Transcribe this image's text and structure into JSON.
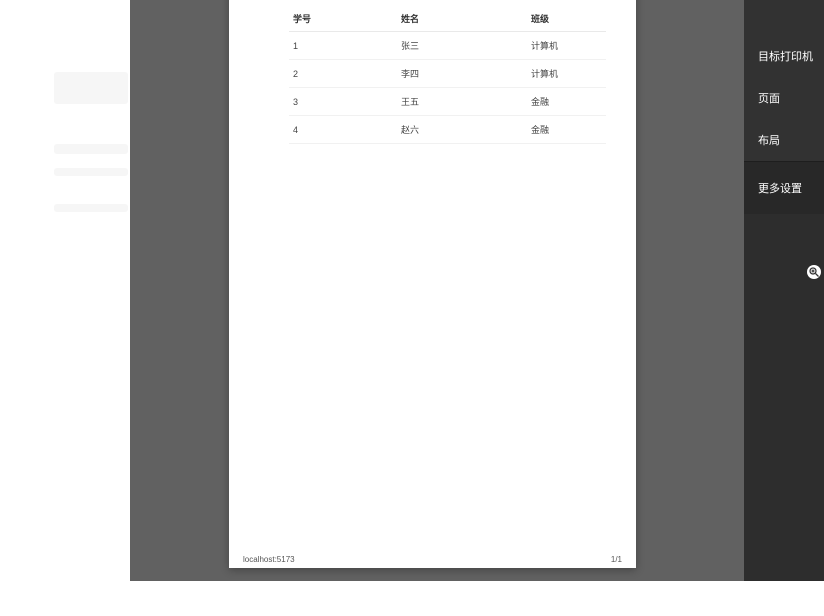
{
  "table": {
    "headers": [
      "学号",
      "姓名",
      "班级"
    ],
    "rows": [
      [
        "1",
        "张三",
        "计算机"
      ],
      [
        "2",
        "李四",
        "计算机"
      ],
      [
        "3",
        "王五",
        "金融"
      ],
      [
        "4",
        "赵六",
        "金融"
      ]
    ]
  },
  "footer": {
    "left": "localhost:5173",
    "right": "1/1"
  },
  "settings": {
    "printer_label": "目标打印机",
    "pages_label": "页面",
    "layout_label": "布局",
    "more_label": "更多设置"
  }
}
